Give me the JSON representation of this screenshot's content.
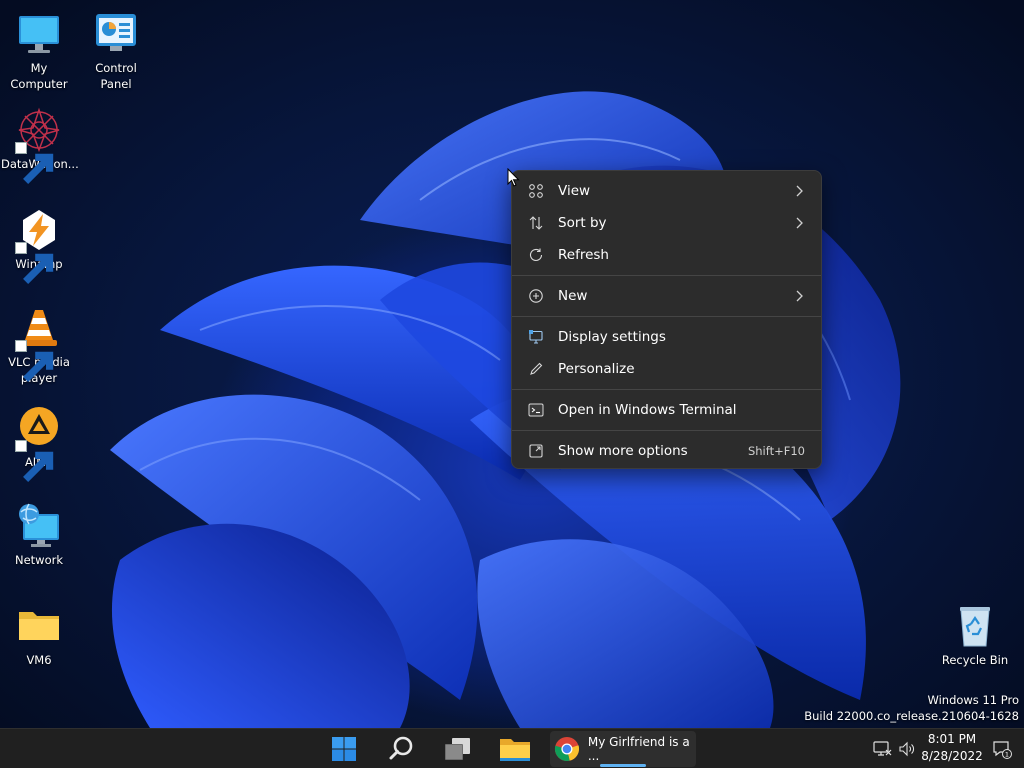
{
  "desktop": {
    "icons": [
      {
        "label": "My Computer",
        "icon": "monitor-icon"
      },
      {
        "label": "Control Panel",
        "icon": "control-panel-icon"
      },
      {
        "label": "DataWagon...",
        "icon": "datawagon-icon",
        "shortcut": true
      },
      {
        "label": "Winamp",
        "icon": "winamp-icon",
        "shortcut": true
      },
      {
        "label": "VLC media player",
        "icon": "vlc-cone-icon",
        "shortcut": true
      },
      {
        "label": "AIMP",
        "icon": "aimp-icon",
        "shortcut": true
      },
      {
        "label": "Network",
        "icon": "network-globe-icon"
      },
      {
        "label": "VM6",
        "icon": "folder-icon"
      },
      {
        "label": "Recycle Bin",
        "icon": "recycle-bin-icon"
      }
    ]
  },
  "context_menu": {
    "items": [
      {
        "label": "View",
        "icon": "grid-icon",
        "submenu": true
      },
      {
        "label": "Sort by",
        "icon": "sort-arrows-icon",
        "submenu": true
      },
      {
        "label": "Refresh",
        "icon": "refresh-icon"
      },
      {
        "label": "New",
        "icon": "plus-circle-icon",
        "submenu": true
      },
      {
        "label": "Display settings",
        "icon": "display-settings-icon"
      },
      {
        "label": "Personalize",
        "icon": "pen-icon"
      },
      {
        "label": "Open in Windows Terminal",
        "icon": "terminal-icon"
      },
      {
        "label": "Show more options",
        "icon": "expand-icon",
        "shortcut": "Shift+F10"
      }
    ]
  },
  "watermark": {
    "line1": "Windows 11 Pro",
    "line2": "Build 22000.co_release.210604-1628"
  },
  "taskbar": {
    "buttons": [
      "start-icon",
      "search-icon",
      "task-view-icon",
      "file-explorer-icon"
    ],
    "running_app": {
      "label": "My Girlfriend is a ...",
      "icon": "chrome-icon"
    },
    "tray_icons": [
      "network-icon",
      "volume-icon"
    ],
    "clock": {
      "time": "8:01 PM",
      "date": "8/28/2022"
    },
    "notification_count": "1"
  },
  "colors": {
    "menu_bg": "#2c2c2c",
    "taskbar_bg": "#202020",
    "accent": "#5fb2f2",
    "wallpaper_blue": "#1738b8"
  }
}
